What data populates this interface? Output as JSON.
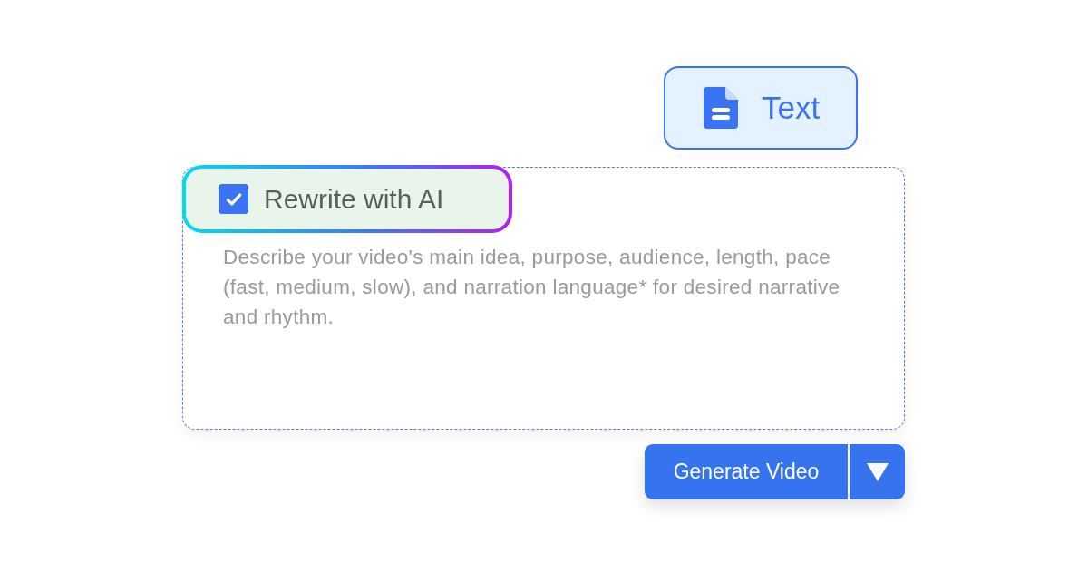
{
  "mode_button": {
    "label": "Text",
    "selected": true
  },
  "rewrite_option": {
    "label": "Rewrite with AI",
    "checked": true
  },
  "prompt": {
    "placeholder": "Describe your video's main idea, purpose, audience, length, pace (fast, medium, slow), and narration language* for desired narrative and rhythm."
  },
  "generate_button": {
    "label": "Generate Video"
  }
}
